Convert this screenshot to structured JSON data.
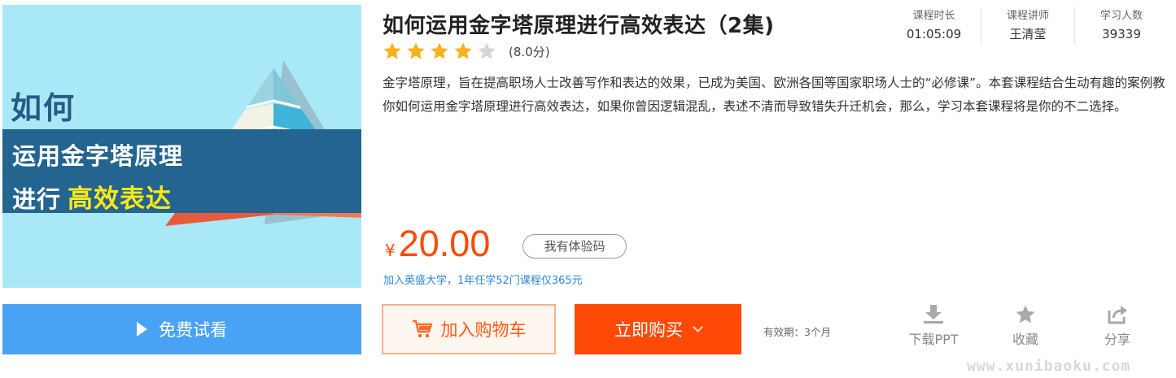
{
  "cover": {
    "line1": "如何",
    "line2": "运用金字塔原理",
    "line3_prefix": "进行",
    "line3_highlight": "高效表达",
    "bg_color": "#a9e9f7",
    "band_color": "#236490",
    "highlight_color": "#ffe81a"
  },
  "course": {
    "title": "如何运用金字塔原理进行高效表达（2集)",
    "stats": [
      {
        "label": "课程时长",
        "value": "01:05:09"
      },
      {
        "label": "课程讲师",
        "value": "王清莹"
      },
      {
        "label": "学习人数",
        "value": "39339"
      }
    ],
    "rating": {
      "stars_filled": 4,
      "stars_total": 5,
      "score_text": "(8.0分)"
    },
    "description": "金字塔原理，旨在提高职场人士改善写作和表达的效果，已成为美国、欧洲各国等国家职场人士的“必修课”。本套课程结合生动有趣的案例教你如何运用金字塔原理进行高效表达，如果你曾因逻辑混乱，表述不清而导致错失升迁机会，那么，学习本套课程将是你的不二选择。"
  },
  "price": {
    "currency": "¥",
    "amount": "20.00",
    "coupon_label": "我有体验码",
    "promo_text": "加入英盛大学，1年任学52门课程仅365元",
    "color": "#ff4a00"
  },
  "actions": {
    "trial_label": "免费试看",
    "cart_label": "加入购物车",
    "buy_label": "立即购买",
    "validity_text": "有效期：3个月"
  },
  "tools": {
    "download_label": "下载PPT",
    "favorite_label": "收藏",
    "share_label": "分享"
  },
  "watermark": "www.xunibaoku.com",
  "icons": {
    "trial": "play-icon",
    "cart": "cart-icon",
    "buy": "chevron-down-icon",
    "download": "download-icon",
    "favorite": "star-icon",
    "share": "share-icon",
    "rating": "star-icon"
  }
}
